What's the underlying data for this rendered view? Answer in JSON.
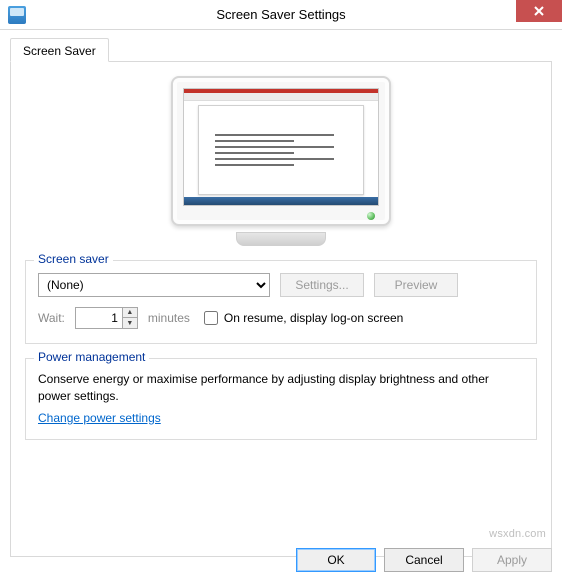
{
  "window": {
    "title": "Screen Saver Settings"
  },
  "tab": {
    "label": "Screen Saver"
  },
  "screensaver_group": {
    "legend": "Screen saver",
    "dropdown_value": "(None)",
    "settings_button": "Settings...",
    "preview_button": "Preview",
    "wait_label": "Wait:",
    "wait_value": "1",
    "wait_unit": "minutes",
    "resume_checkbox_label": "On resume, display log-on screen",
    "resume_checked": false
  },
  "power_group": {
    "legend": "Power management",
    "description": "Conserve energy or maximise performance by adjusting display brightness and other power settings.",
    "link_text": "Change power settings"
  },
  "buttons": {
    "ok": "OK",
    "cancel": "Cancel",
    "apply": "Apply"
  },
  "watermark": "wsxdn.com"
}
